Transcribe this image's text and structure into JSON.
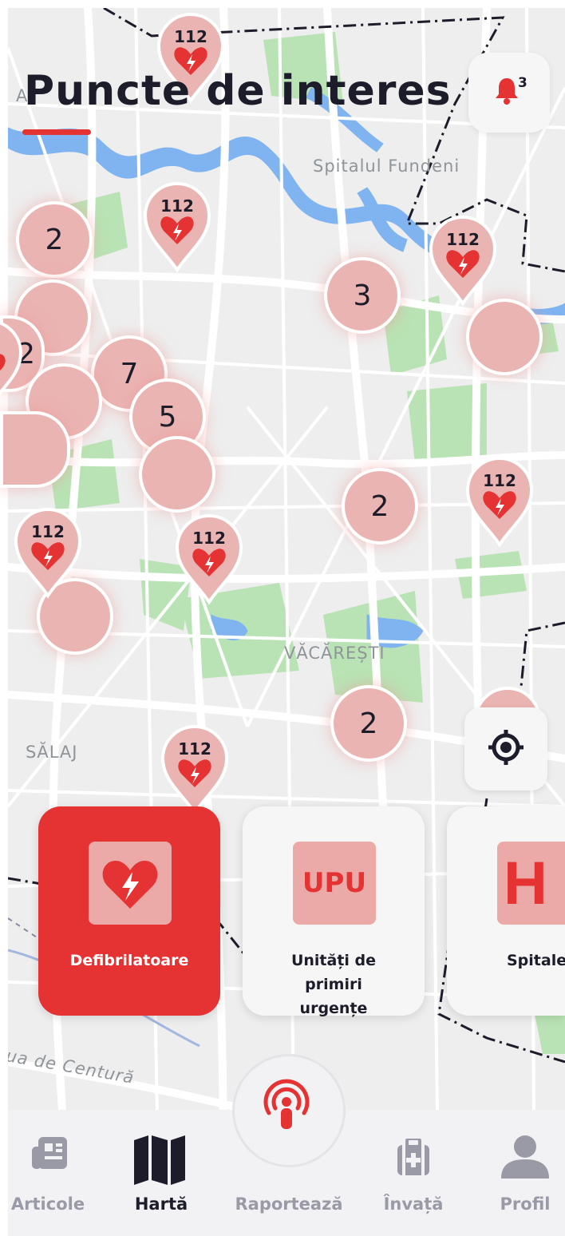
{
  "screen": {
    "title": "Puncte de interes",
    "notifications": {
      "count": "3",
      "icon": "bell-icon"
    },
    "accent_color": "#e53232"
  },
  "map": {
    "labels": {
      "spitalul_fundeni": "Spitalul Fundeni",
      "vacaresti": "VĂCĂREȘTI",
      "salaj": "SĂLAJ",
      "soseaua": "ua de Centură",
      "partial_a": "A"
    },
    "clusters": {
      "c1": "2",
      "c2": "3",
      "c3": "2",
      "c4": "7",
      "c5": "5",
      "c6": "2",
      "c7": "2",
      "c8": "",
      "c9": "",
      "c10": "",
      "c11": "",
      "c12": "",
      "c13": ""
    },
    "pin_text": "112"
  },
  "categories": [
    {
      "label": "Defibrilatoare",
      "icon": "defibrillator-heart-icon",
      "selected": true
    },
    {
      "label": "Unități de primiri urgențe",
      "icon_text": "UPU",
      "selected": false
    },
    {
      "label": "Spitale",
      "icon_text": "H",
      "selected": false
    }
  ],
  "tabs": [
    {
      "label": "Articole",
      "icon": "articles-icon",
      "active": false
    },
    {
      "label": "Hartă",
      "icon": "map-icon",
      "active": true
    },
    {
      "label": "Raportează",
      "icon": "broadcast-icon",
      "active": false
    },
    {
      "label": "Învață",
      "icon": "first-aid-kit-icon",
      "active": false
    },
    {
      "label": "Profil",
      "icon": "profile-icon",
      "active": false
    }
  ]
}
